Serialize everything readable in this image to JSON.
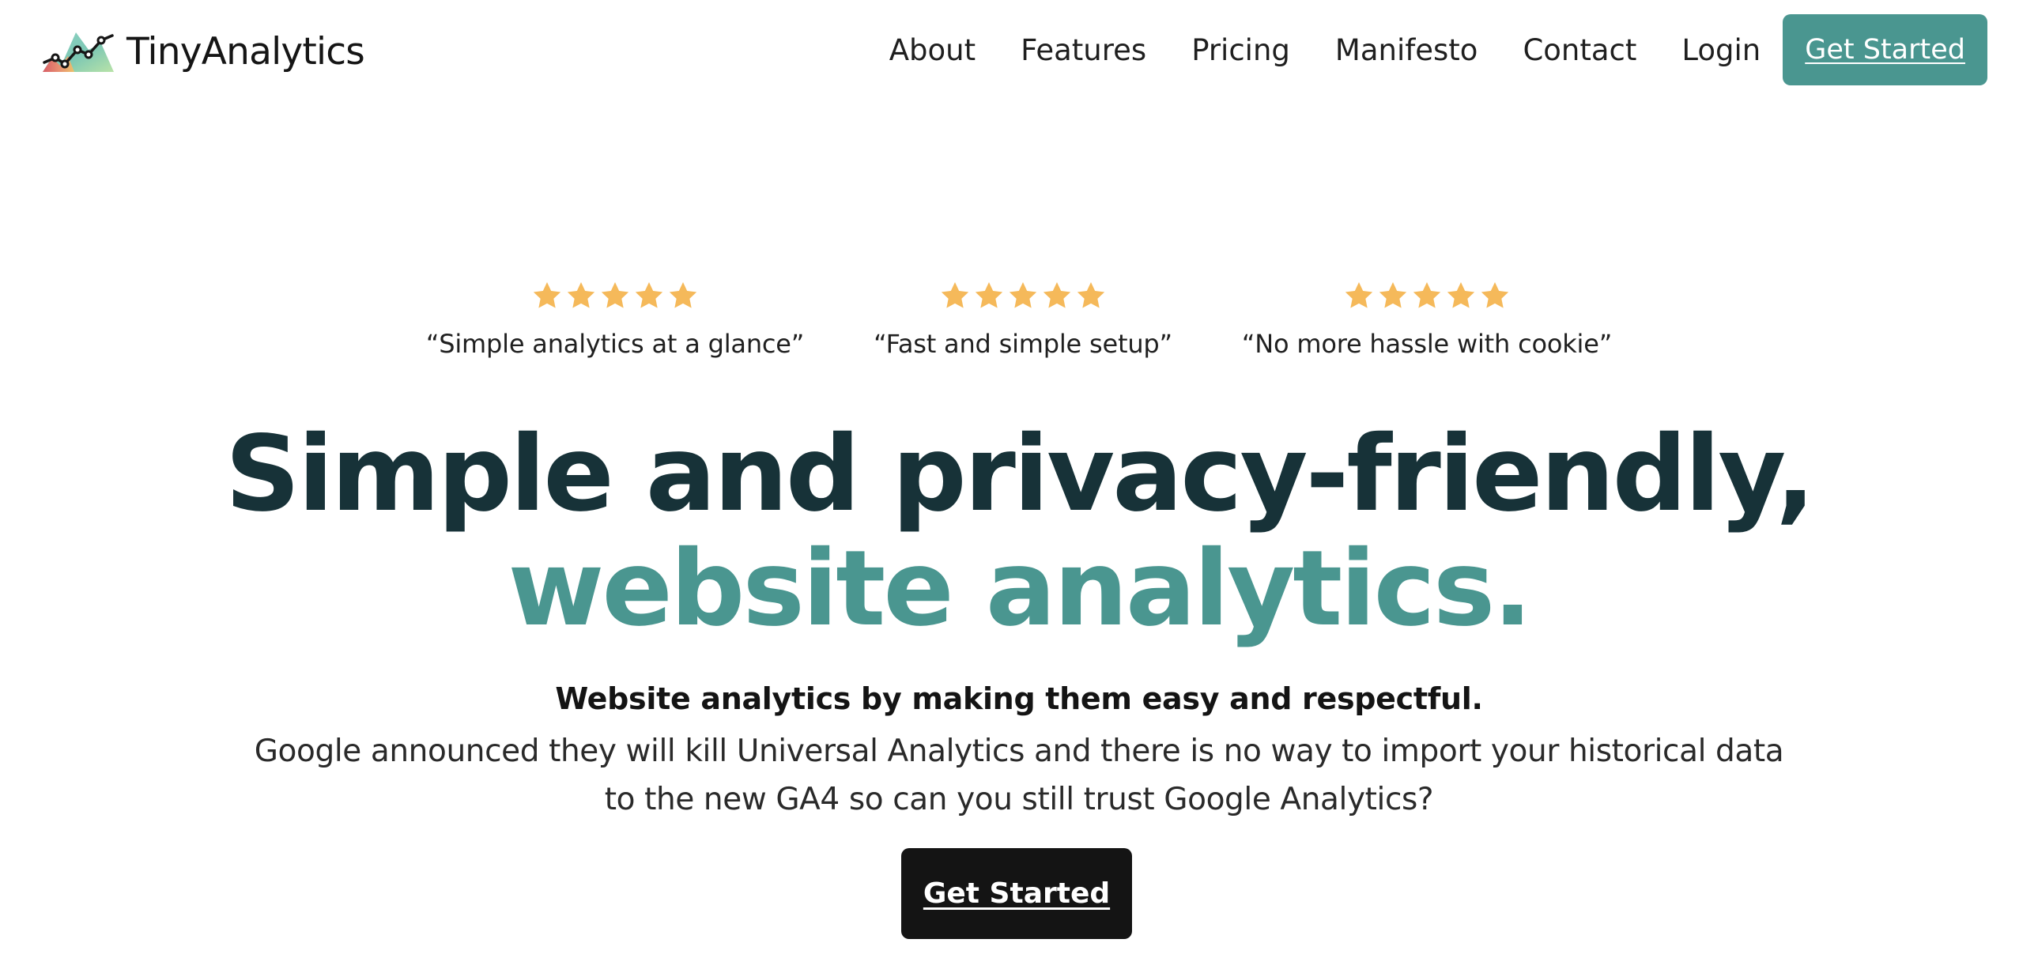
{
  "brand": {
    "name": "TinyAnalytics",
    "logo_icon": "analytics-line-chart-icon"
  },
  "nav": {
    "links": [
      {
        "label": "About"
      },
      {
        "label": "Features"
      },
      {
        "label": "Pricing"
      },
      {
        "label": "Manifesto"
      },
      {
        "label": "Contact"
      },
      {
        "label": "Login"
      }
    ],
    "cta_label": "Get Started",
    "cta_color": "#4a9690"
  },
  "reviews": [
    {
      "rating": 5,
      "quote": "“Simple analytics at a glance”"
    },
    {
      "rating": 5,
      "quote": "“Fast and simple setup”"
    },
    {
      "rating": 5,
      "quote": "“No more hassle with cookie”"
    }
  ],
  "star_color": "#f5b95a",
  "hero": {
    "title_line1": "Simple and privacy-friendly,",
    "title_line2": "website analytics.",
    "title_color": "#173238",
    "accent_color": "#4a9690",
    "subtitle_bold": "Website analytics by making them easy and respectful.",
    "subtitle_text": "Google announced they will kill Universal Analytics and there is no way to import your historical data to the new GA4 so can you still trust Google Analytics?",
    "cta_label": "Get Started",
    "cta_color": "#141414"
  }
}
